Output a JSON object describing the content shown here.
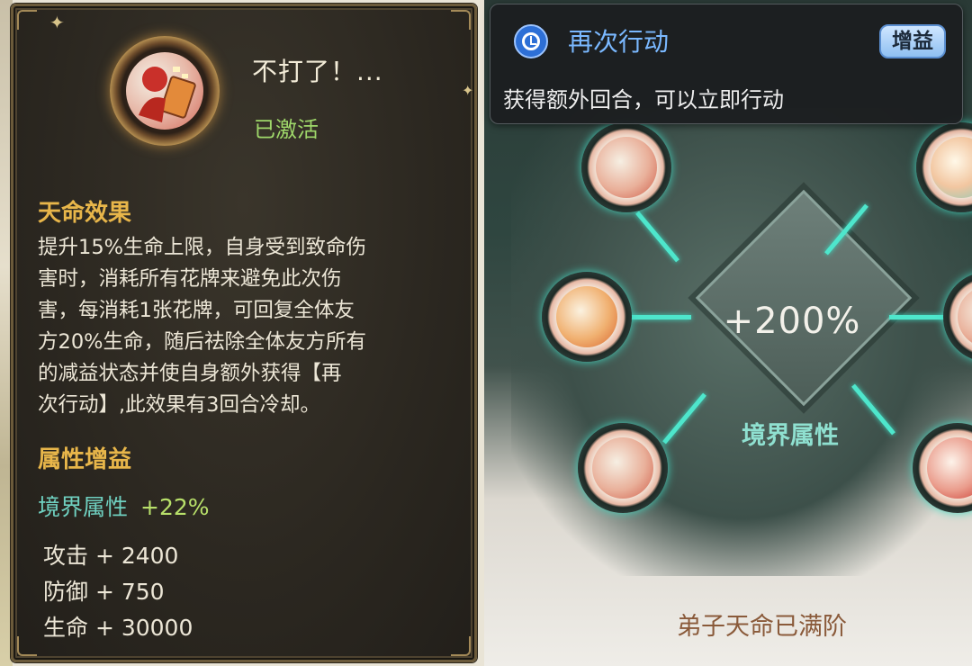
{
  "skill": {
    "name": "不打了！...",
    "status": "已激活"
  },
  "sections": {
    "effect_title": "天命效果",
    "attr_title": "属性增益"
  },
  "description_lines": [
    "提升15%生命上限，自身受到致命伤",
    "害时，消耗所有花牌来避免此次伤",
    "害，每消耗1张花牌，可回复全体友",
    "方20%生命，随后祛除全体友方所有",
    "的减益状态并使自身额外获得【再",
    "次行动】,此效果有3回合冷却。"
  ],
  "realm": {
    "label": "境界属性",
    "bonus": "+22%"
  },
  "stats": [
    "攻击 + 2400",
    "防御 + 750",
    "生命 + 30000"
  ],
  "tooltip": {
    "icon": "clock-icon",
    "title": "再次行动",
    "badge": "增益",
    "text": "获得额外回合，可以立即行动"
  },
  "tree": {
    "center_value": "+200%",
    "center_label": "境界属性",
    "footer": "弟子天命已满阶"
  },
  "colors": {
    "accent_gold": "#e8b64a",
    "active_green": "#9fd86a",
    "realm_teal": "#6fd0c0",
    "node_glow": "#4ee6cc",
    "tooltip_blue": "#7ab8ff"
  }
}
